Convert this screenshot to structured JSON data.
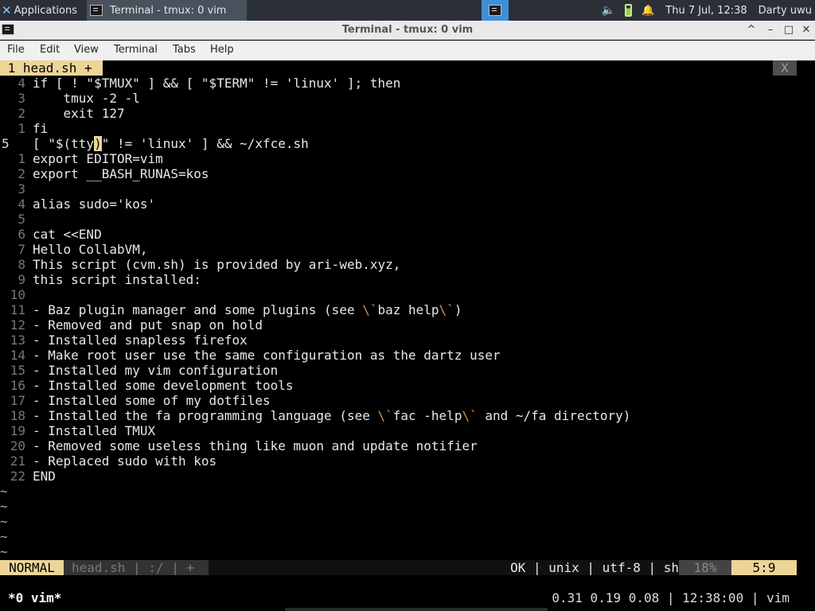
{
  "panel": {
    "applications_label": "Applications",
    "task_label": "Terminal - tmux: 0 vim",
    "clock": "Thu  7 Jul, 12:38",
    "user": "Darty uwu",
    "icons": [
      "xfce-logo-icon",
      "terminal-icon",
      "volume-icon",
      "battery-icon",
      "notification-bell-icon"
    ]
  },
  "window": {
    "title": "Terminal - tmux: 0 vim",
    "controls": [
      "^",
      "–",
      "□",
      "✕"
    ]
  },
  "menu": [
    "File",
    "Edit",
    "View",
    "Terminal",
    "Tabs",
    "Help"
  ],
  "vim": {
    "tab_label": " 1 head.sh + ",
    "tab_close": "X",
    "lines": [
      {
        "n": "4",
        "text": "if [ ! \"$TMUX\" ] && [ \"$TERM\" != 'linux' ]; then"
      },
      {
        "n": "3",
        "text": "    tmux -2 -l"
      },
      {
        "n": "2",
        "text": "    exit 127"
      },
      {
        "n": "1",
        "text": "fi"
      },
      {
        "n": "5",
        "text": "[ \"$(tty)\" != 'linux' ] && ~/xfce.sh",
        "current": true
      },
      {
        "n": "1",
        "text": "export EDITOR=vim"
      },
      {
        "n": "2",
        "text": "export __BASH_RUNAS=kos"
      },
      {
        "n": "3",
        "text": ""
      },
      {
        "n": "4",
        "text": "alias sudo='kos'"
      },
      {
        "n": "5",
        "text": ""
      },
      {
        "n": "6",
        "text": "cat <<END"
      },
      {
        "n": "7",
        "text": "Hello CollabVM,"
      },
      {
        "n": "8",
        "text": "This script (cvm.sh) is provided by ari-web.xyz,"
      },
      {
        "n": "9",
        "text": "this script installed:"
      },
      {
        "n": "10",
        "text": ""
      },
      {
        "n": "11",
        "text": "- Baz plugin manager and some plugins (see \\`baz help\\`)"
      },
      {
        "n": "12",
        "text": "- Removed and put snap on hold"
      },
      {
        "n": "13",
        "text": "- Installed snapless firefox"
      },
      {
        "n": "14",
        "text": "- Make root user use the same configuration as the dartz user"
      },
      {
        "n": "15",
        "text": "- Installed my vim configuration"
      },
      {
        "n": "16",
        "text": "- Installed some development tools"
      },
      {
        "n": "17",
        "text": "- Installed some of my dotfiles"
      },
      {
        "n": "18",
        "text": "- Installed the fa programming language (see \\`fac -help\\` and ~/fa directory)"
      },
      {
        "n": "19",
        "text": "- Installed TMUX"
      },
      {
        "n": "20",
        "text": "- Removed some useless thing like muon and update notifier"
      },
      {
        "n": "21",
        "text": "- Replaced sudo with kos"
      },
      {
        "n": "22",
        "text": "END"
      }
    ],
    "tildes": [
      "~",
      "~",
      "~",
      "~",
      "~"
    ],
    "status": {
      "mode": "NORMAL",
      "file": "head.sh | :/ | +",
      "info": "OK | unix | utf-8 | sh",
      "percent": "18%",
      "position": "5:9"
    }
  },
  "tmux": {
    "window": "*0 vim*",
    "right": "0.31 0.19 0.08 | 12:38:00 | vim"
  },
  "colors": {
    "accent_yellow": "#ecd597",
    "escape_orange": "#d98f4e",
    "panel_bg": "#2b3038",
    "pager_blue": "#3f8fd8"
  }
}
